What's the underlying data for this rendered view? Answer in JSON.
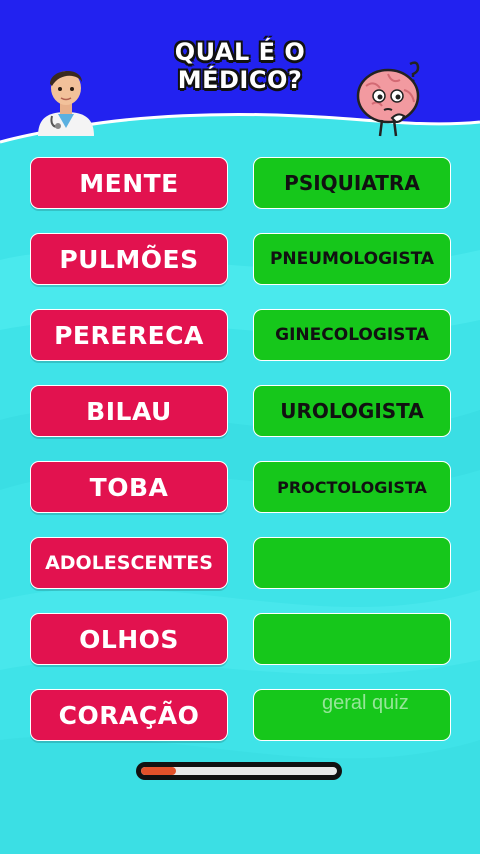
{
  "header": {
    "title_line1": "QUAL É O",
    "title_line2": "MÉDICO?"
  },
  "rows": [
    {
      "word": "MENTE",
      "answer": "PSIQUIATRA"
    },
    {
      "word": "PULMÕES",
      "answer": "PNEUMOLOGISTA"
    },
    {
      "word": "PERERECA",
      "answer": "GINECOLOGISTA"
    },
    {
      "word": "BILAU",
      "answer": "UROLOGISTA"
    },
    {
      "word": "TOBA",
      "answer": "PROCTOLOGISTA"
    },
    {
      "word": "ADOLESCENTES",
      "answer": ""
    },
    {
      "word": "OLHOS",
      "answer": ""
    },
    {
      "word": "CORAÇÃO",
      "answer": ""
    }
  ],
  "watermark": "geral quiz",
  "progress": {
    "fraction": 0.18
  },
  "colors": {
    "header_blue": "#2222f0",
    "background_cyan": "#3fe3e8",
    "word_red": "#e2124f",
    "answer_green": "#16c71b",
    "progress_fill": "#e2512a"
  },
  "icons": {
    "left": "doctor-icon",
    "right": "thinking-brain-icon"
  }
}
